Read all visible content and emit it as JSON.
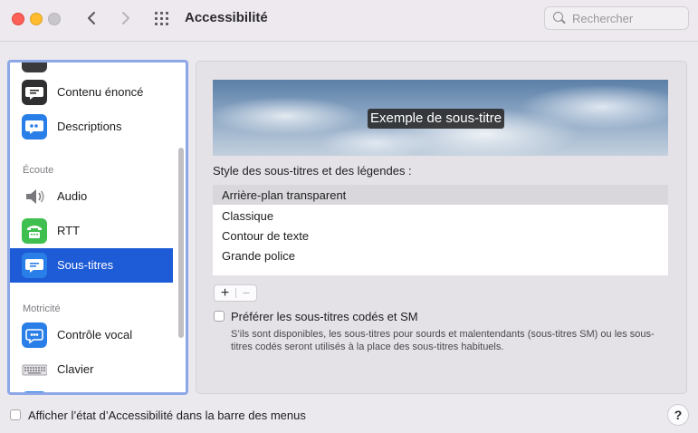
{
  "window": {
    "title": "Accessibilité",
    "search_placeholder": "Rechercher"
  },
  "sidebar": {
    "items": [
      {
        "label": "Contenu énoncé",
        "icon": "speech-bubble-icon"
      },
      {
        "label": "Descriptions",
        "icon": "quote-bubble-icon"
      },
      {
        "label": "Audio",
        "icon": "speaker-icon"
      },
      {
        "label": "RTT",
        "icon": "teletype-icon"
      },
      {
        "label": "Sous-titres",
        "icon": "captions-icon",
        "selected": true
      },
      {
        "label": "Contrôle vocal",
        "icon": "voice-control-icon"
      },
      {
        "label": "Clavier",
        "icon": "keyboard-icon"
      }
    ],
    "sections": {
      "hearing": "Écoute",
      "motor": "Motricité"
    }
  },
  "main": {
    "preview_caption": "Exemple de sous-titre",
    "style_label": "Style des sous-titres et des légendes :",
    "styles": [
      {
        "label": "Arrière-plan transparent",
        "selected": true
      },
      {
        "label": "Classique"
      },
      {
        "label": "Contour de texte"
      },
      {
        "label": "Grande police"
      }
    ],
    "add_label": "+",
    "remove_label": "−",
    "prefer_sdh_label": "Préférer les sous-titres codés et SM",
    "prefer_sdh_checked": false,
    "prefer_sdh_description": "S’ils sont disponibles, les sous-titres pour sourds et malentendants (sous-titres SM) ou les sous-titres codés seront utilisés à la place des sous-titres habituels."
  },
  "footer": {
    "menu_status_label": "Afficher l’état d’Accessibilité dans la barre des menus",
    "menu_status_checked": false,
    "help_label": "?"
  },
  "colors": {
    "accent": "#1e5bd6",
    "sidebar_focus": "#8ea7e6"
  }
}
